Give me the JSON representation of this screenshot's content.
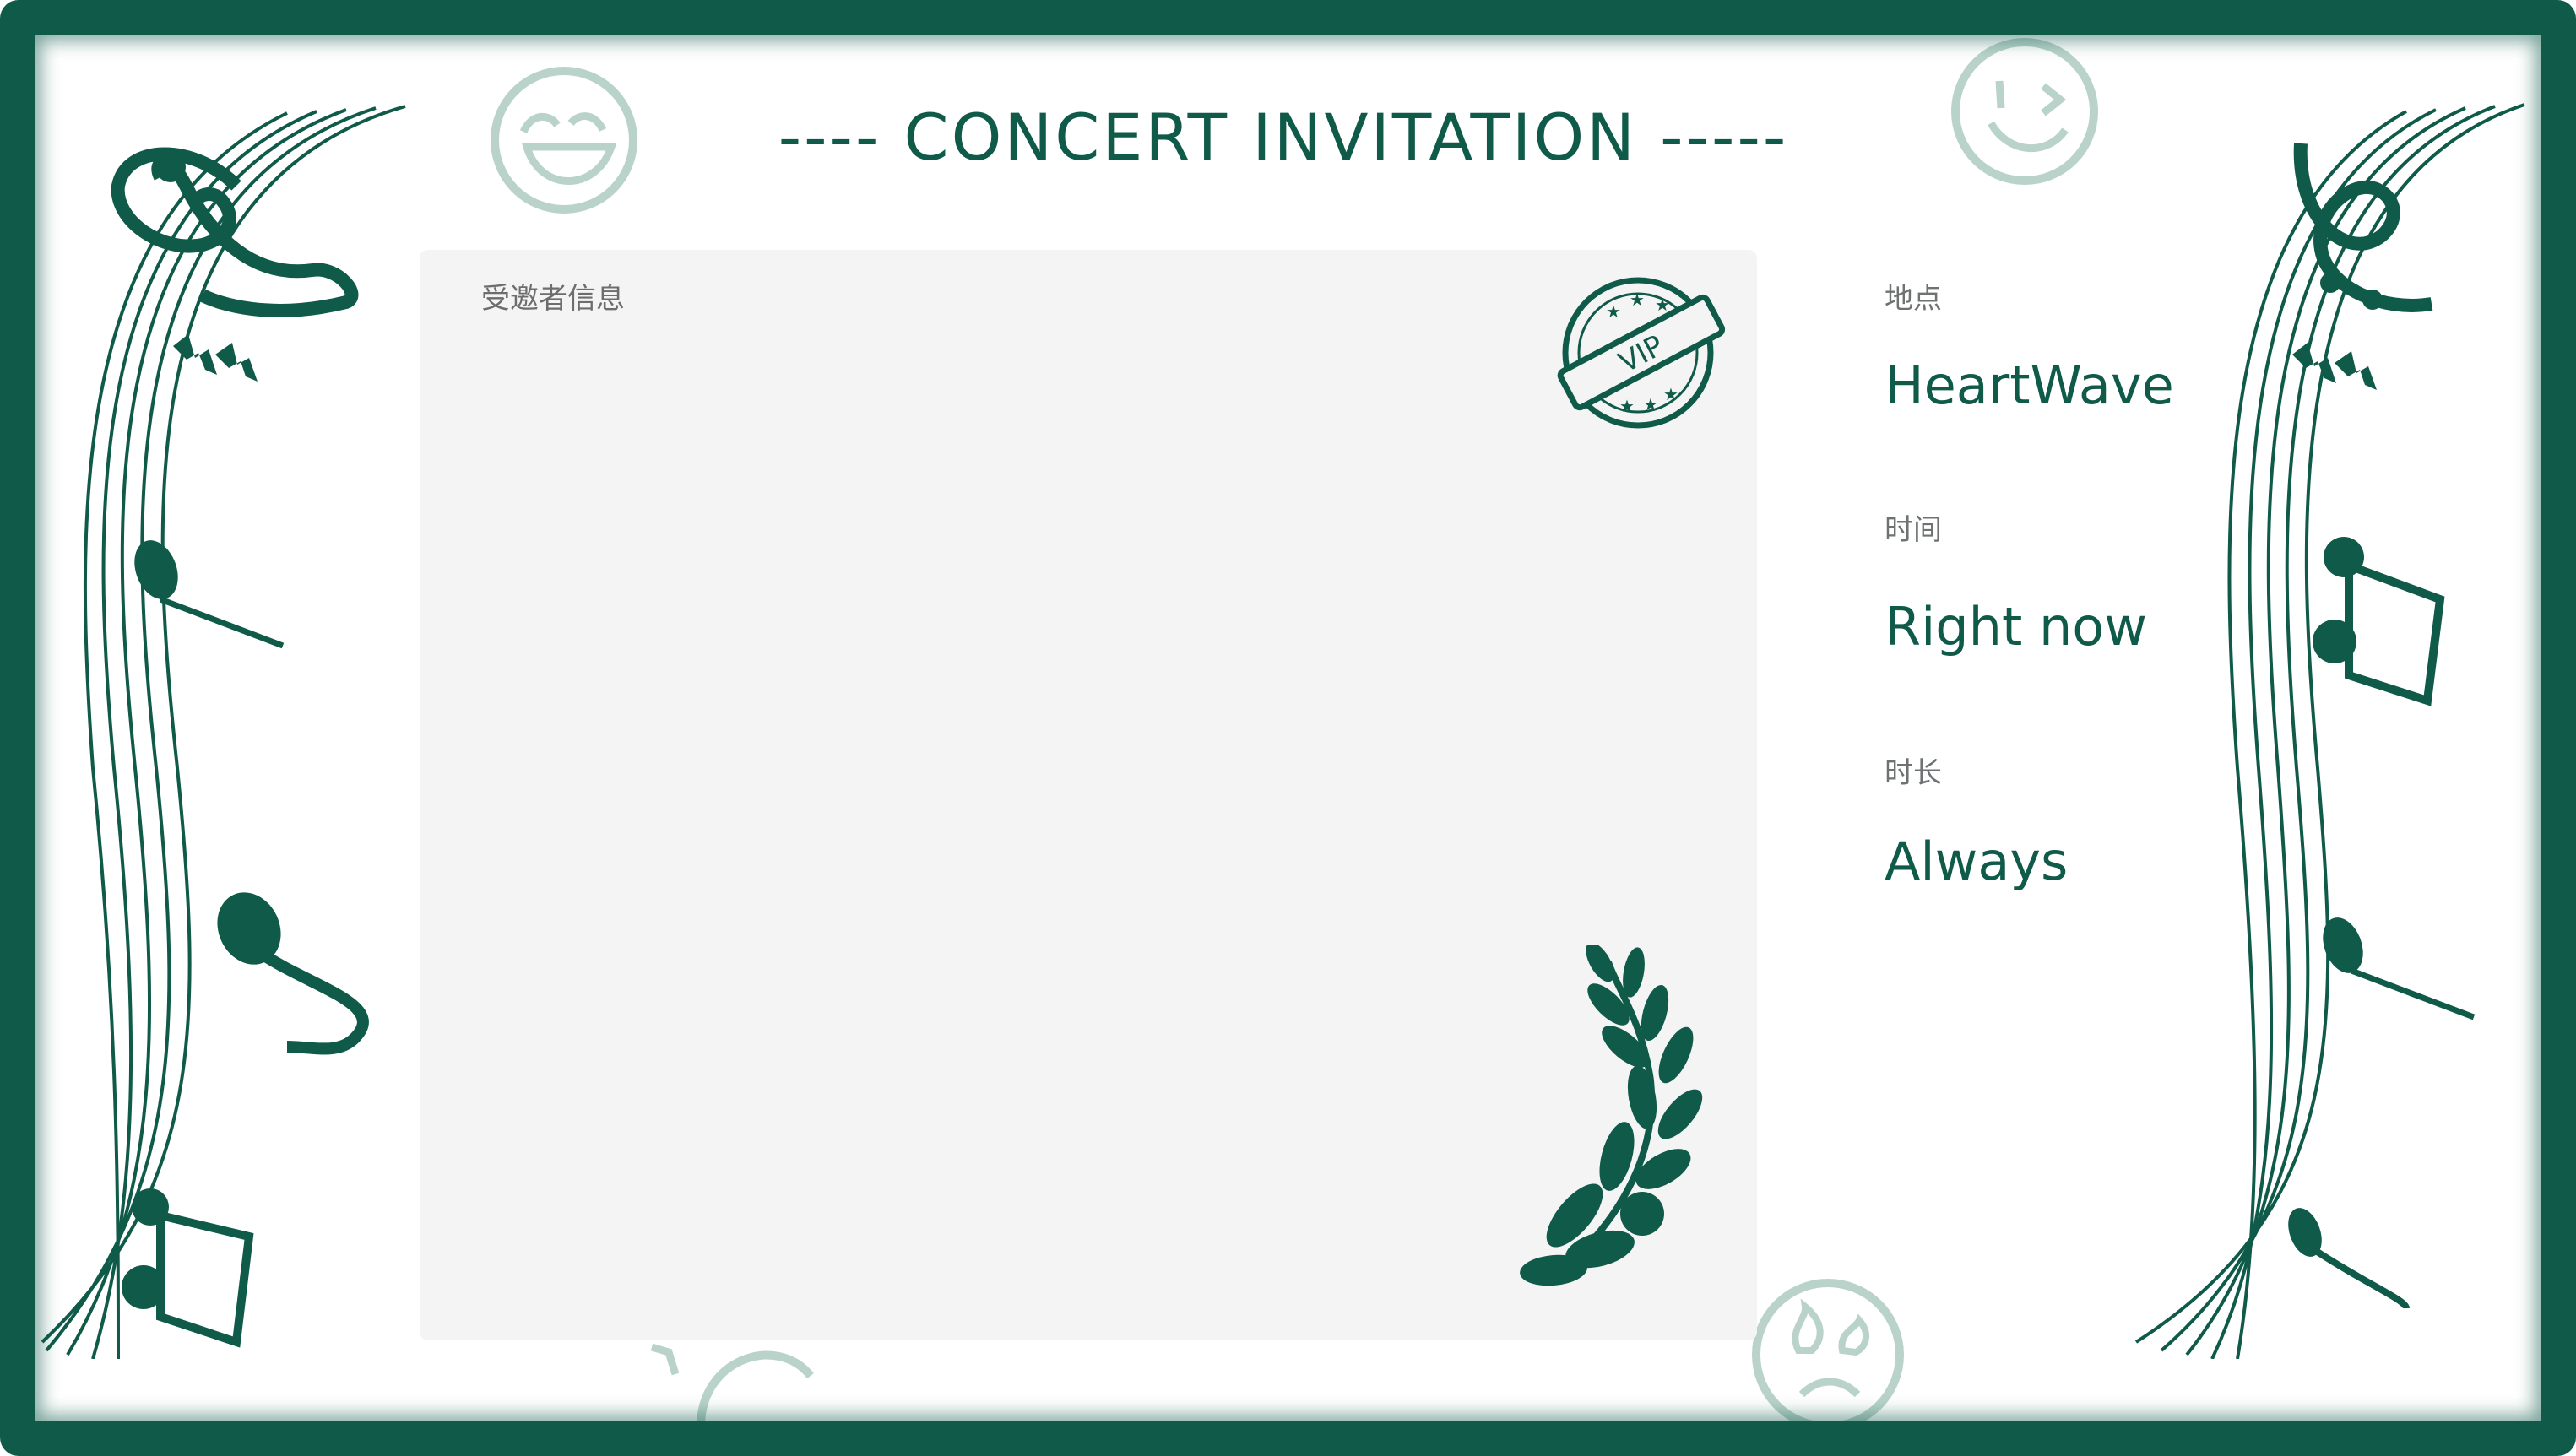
{
  "header": {
    "title": "---- CONCERT INVITATION -----"
  },
  "invitee_panel": {
    "label": "受邀者信息",
    "stamp_text": "VIP"
  },
  "details": {
    "location": {
      "label": "地点",
      "value": "HeartWave"
    },
    "time": {
      "label": "时间",
      "value": "Right now"
    },
    "duration": {
      "label": "时长",
      "value": "Always"
    }
  },
  "colors": {
    "primary": "#0f5a48",
    "faded": "#b9d3cb",
    "panel": "#f4f4f4",
    "label": "#6f7272"
  },
  "icons": [
    "treble-clef-icon",
    "music-note-icon",
    "emoji-icon",
    "vip-stamp-icon",
    "laurel-branch-icon"
  ]
}
